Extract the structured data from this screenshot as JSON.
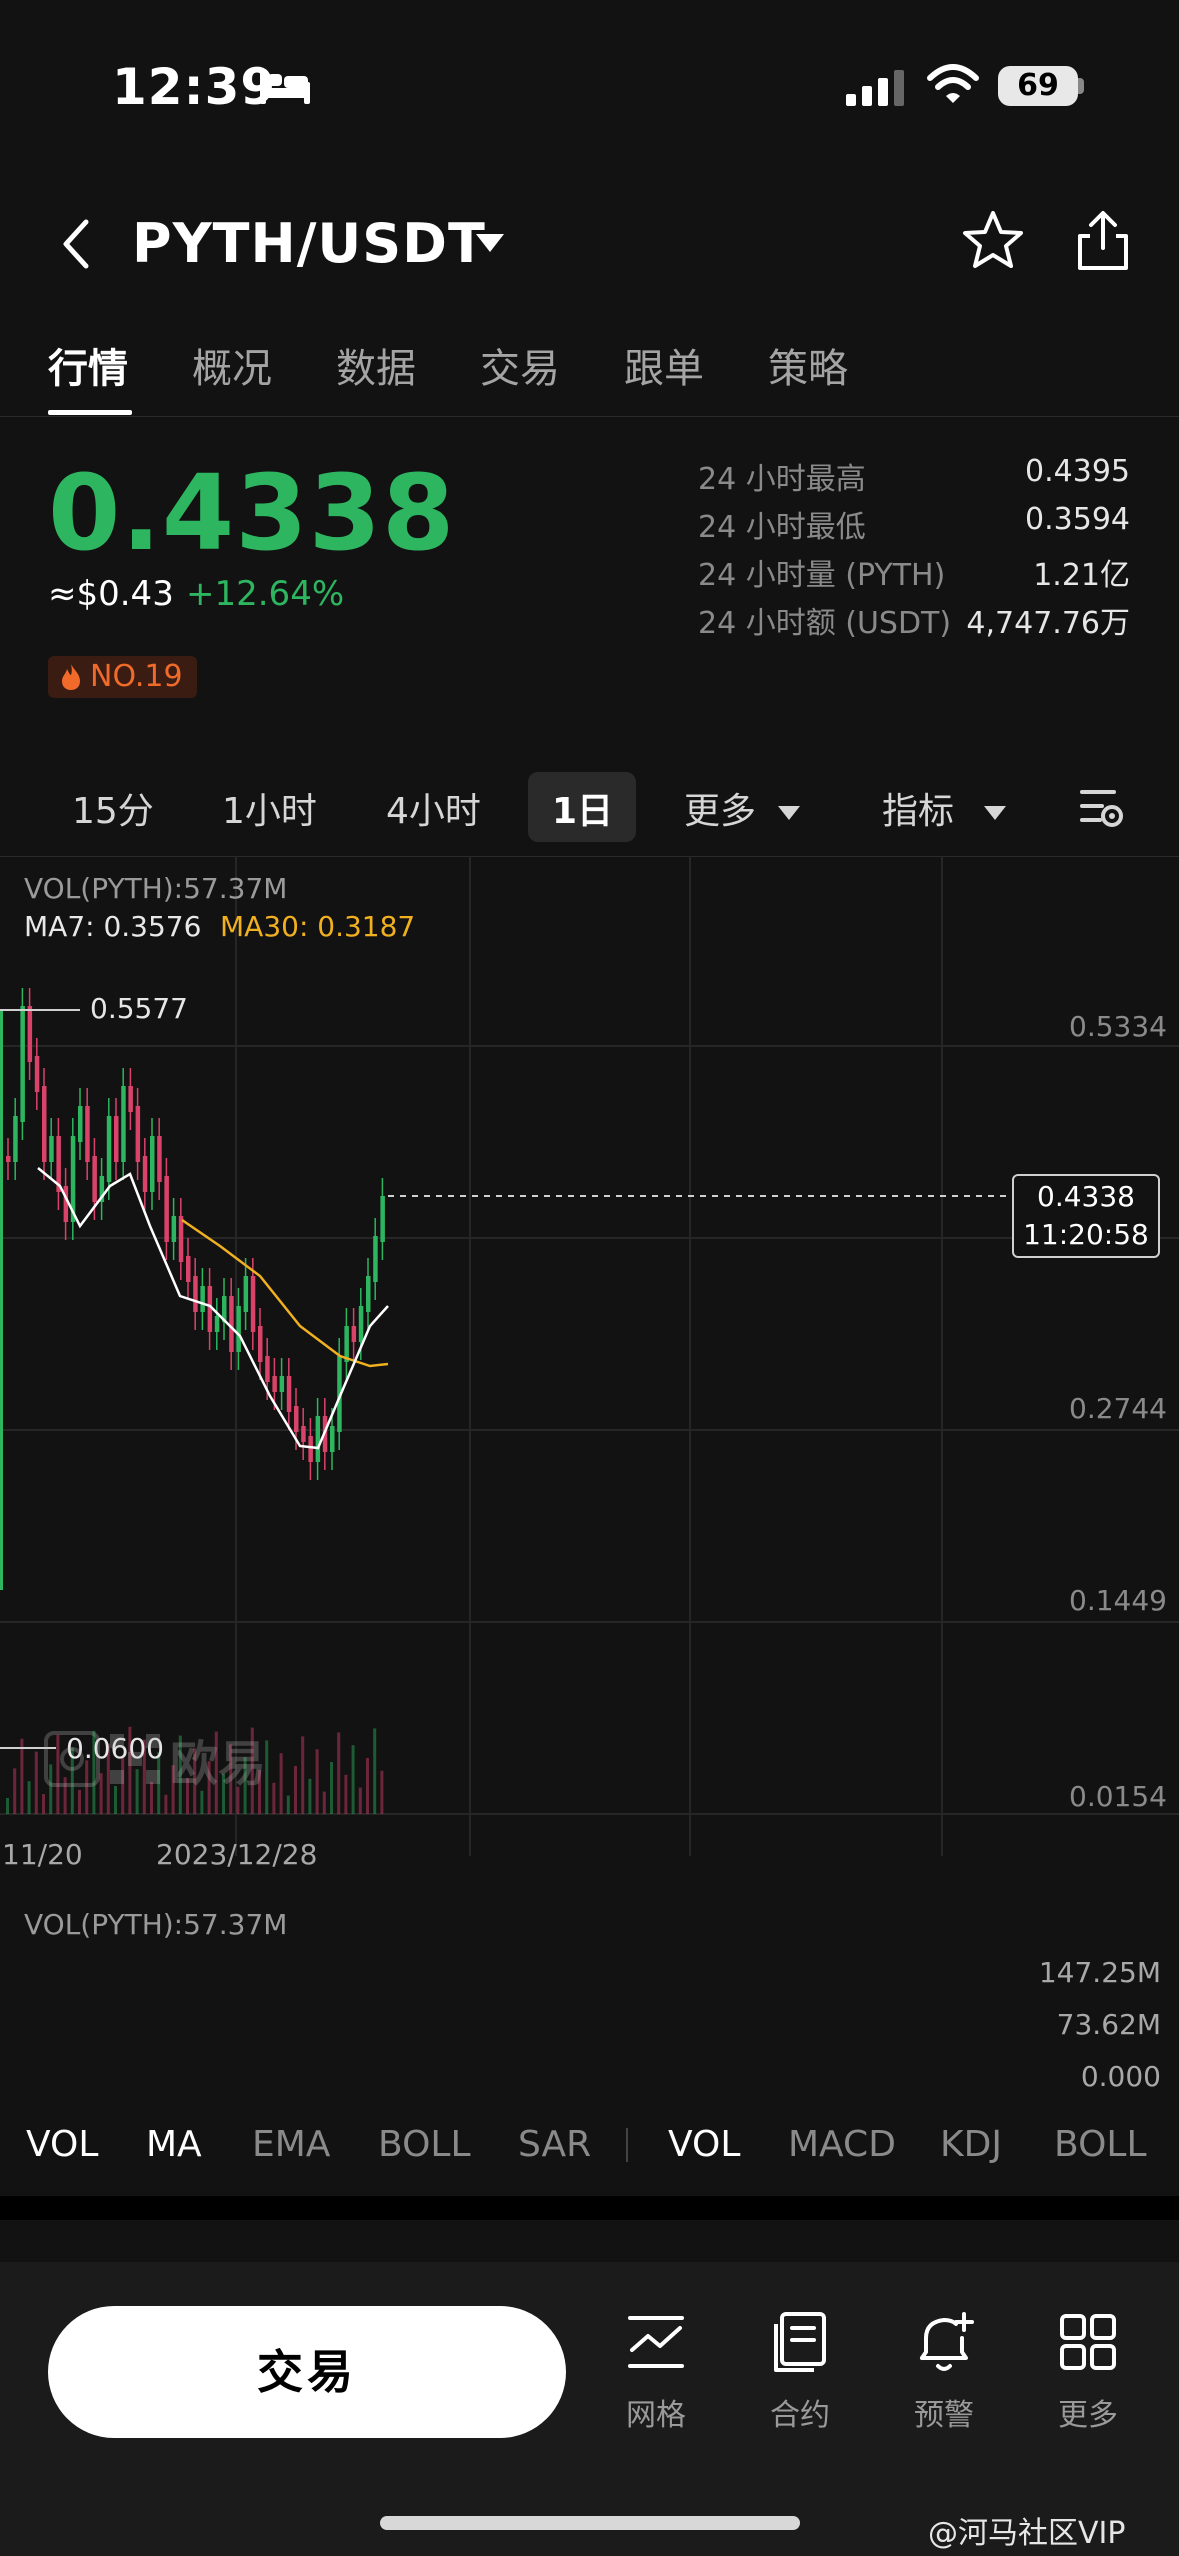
{
  "status_bar": {
    "time": "12:39",
    "battery": "69"
  },
  "header": {
    "pair": "PYTH/USDT"
  },
  "tabs": [
    "行情",
    "概况",
    "数据",
    "交易",
    "跟单",
    "策略"
  ],
  "price": {
    "last": "0.4338",
    "usd": "≈$0.43",
    "change_pct": "+12.64%",
    "rank": "NO.19"
  },
  "stats": [
    {
      "label": "24 小时最高",
      "value": "0.4395"
    },
    {
      "label": "24 小时最低",
      "value": "0.3594"
    },
    {
      "label": "24 小时量 (PYTH)",
      "value": "1.21亿"
    },
    {
      "label": "24 小时额 (USDT)",
      "value": "4,747.76万"
    }
  ],
  "timeframes": {
    "items": [
      "15分",
      "1小时",
      "4小时",
      "1日"
    ],
    "active": "1日",
    "more": "更多",
    "indicators": "指标"
  },
  "chart_legend": {
    "vol": "VOL(PYTH):57.37M",
    "ma7": "MA7: 0.3576",
    "ma30": "MA30: 0.3187"
  },
  "chart_data": {
    "type": "candlestick",
    "y_axis_ticks": [
      "0.5334",
      "0.2744",
      "0.1449",
      "0.0154"
    ],
    "x_axis_ticks": [
      "11/20",
      "2023/12/28"
    ],
    "high_marker": "0.5577",
    "low_marker": "0.0600",
    "current_price": "0.4338",
    "countdown": "11:20:58",
    "ma7_color": "#ffffff",
    "ma30_color": "#f0b020",
    "up_color": "#2db560",
    "down_color": "#d9436a"
  },
  "watermark": "欧易",
  "volume_panel": {
    "legend": "VOL(PYTH):57.37M",
    "ticks": [
      "147.25M",
      "73.62M",
      "0.000"
    ]
  },
  "indicator_bar": {
    "main": [
      "VOL",
      "MA",
      "EMA",
      "BOLL",
      "SAR"
    ],
    "sub": [
      "VOL",
      "MACD",
      "KDJ",
      "BOLL"
    ],
    "active": [
      "VOL",
      "MA",
      "VOL"
    ]
  },
  "bottom_bar": {
    "trade": "交易",
    "items": [
      "网格",
      "合约",
      "预警",
      "更多"
    ]
  },
  "credit": "@河马社区VIP"
}
